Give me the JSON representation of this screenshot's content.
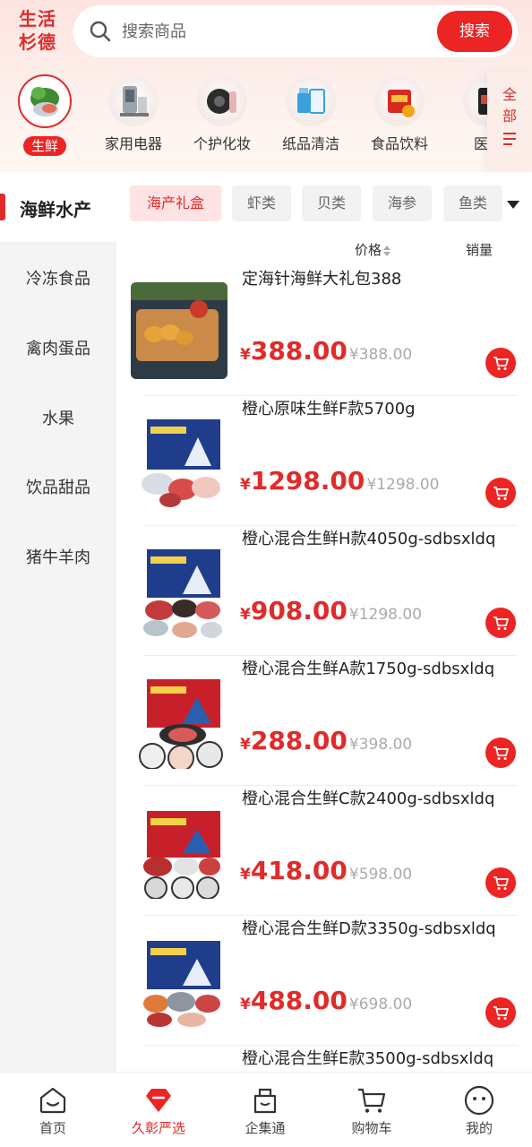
{
  "brand": {
    "line1": "生活",
    "line2": "杉德"
  },
  "search": {
    "placeholder": "搜索商品",
    "button": "搜索"
  },
  "categories": [
    {
      "label": "生鲜",
      "icon": "fresh-food-icon",
      "active": true
    },
    {
      "label": "家用电器",
      "icon": "appliance-icon"
    },
    {
      "label": "个护化妆",
      "icon": "cosmetics-icon"
    },
    {
      "label": "纸品清洁",
      "icon": "paper-cleaning-icon"
    },
    {
      "label": "食品饮料",
      "icon": "food-drink-icon"
    },
    {
      "label": "医药",
      "icon": "medicine-icon"
    }
  ],
  "all_categories": {
    "line1": "全",
    "line2": "部",
    "icon": "list-icon"
  },
  "sidebar": {
    "active": "海鲜水产",
    "items": [
      "冷冻食品",
      "禽肉蛋品",
      "水果",
      "饮品甜品",
      "猪牛羊肉"
    ]
  },
  "subtabs": [
    "海产礼盒",
    "虾类",
    "贝类",
    "海参",
    "鱼类"
  ],
  "sort": {
    "price": "价格",
    "sales": "销量"
  },
  "currency": "¥",
  "products": [
    {
      "name": "定海针海鲜大礼包388",
      "price": "388.00",
      "original": "¥388.00"
    },
    {
      "name": "橙心原味生鲜F款5700g",
      "price": "1298.00",
      "original": "¥1298.00"
    },
    {
      "name": "橙心混合生鲜H款4050g-sdbsxldq",
      "price": "908.00",
      "original": "¥1298.00"
    },
    {
      "name": "橙心混合生鲜A款1750g-sdbsxldq",
      "price": "288.00",
      "original": "¥398.00"
    },
    {
      "name": "橙心混合生鲜C款2400g-sdbsxldq",
      "price": "418.00",
      "original": "¥598.00"
    },
    {
      "name": "橙心混合生鲜D款3350g-sdbsxldq",
      "price": "488.00",
      "original": "¥698.00"
    },
    {
      "name": "橙心混合生鲜E款3500g-sdbsxldq",
      "price": "",
      "original": ""
    }
  ],
  "bottom_nav": [
    {
      "label": "首页",
      "icon": "home-icon"
    },
    {
      "label": "久彰严选",
      "icon": "selection-icon",
      "active": true
    },
    {
      "label": "企集通",
      "icon": "enterprise-bag-icon"
    },
    {
      "label": "购物车",
      "icon": "cart-icon"
    },
    {
      "label": "我的",
      "icon": "profile-icon"
    }
  ],
  "colors": {
    "accent": "#ec2424",
    "header_bg": "#fde4e0",
    "sidebar_bg": "#f4f4f4"
  }
}
